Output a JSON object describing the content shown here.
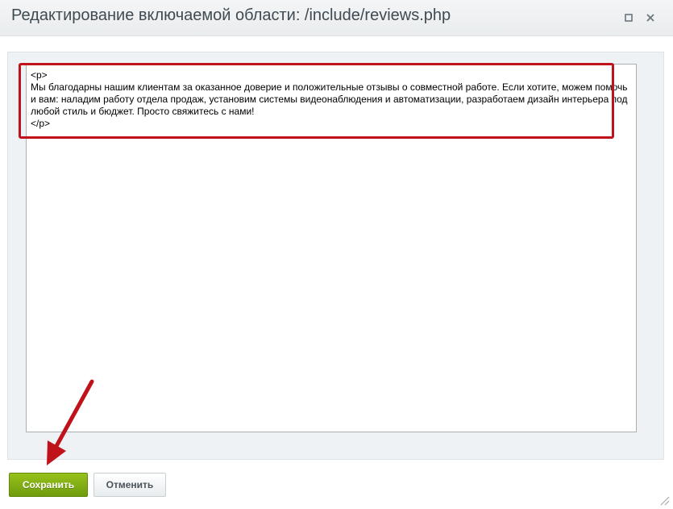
{
  "dialog": {
    "title": "Редактирование включаемой области: /include/reviews.php"
  },
  "editor": {
    "content": "<p>\nМы благодарны нашим клиентам за оказанное доверие и положительные отзывы о совместной работе. Если хотите, можем помочь и вам: наладим работу отдела продаж, установим системы видеонаблюдения и автоматизации, разработаем дизайн интерьера под любой стиль и бюджет. Просто свяжитесь с нами!\n</p>"
  },
  "buttons": {
    "save_label": "Сохранить",
    "cancel_label": "Отменить"
  },
  "icons": {
    "maximize": "maximize-icon",
    "close": "close-icon",
    "resize": "resize-grip-icon"
  },
  "colors": {
    "save_button": "#7fac12",
    "annotation": "#c0121b"
  }
}
